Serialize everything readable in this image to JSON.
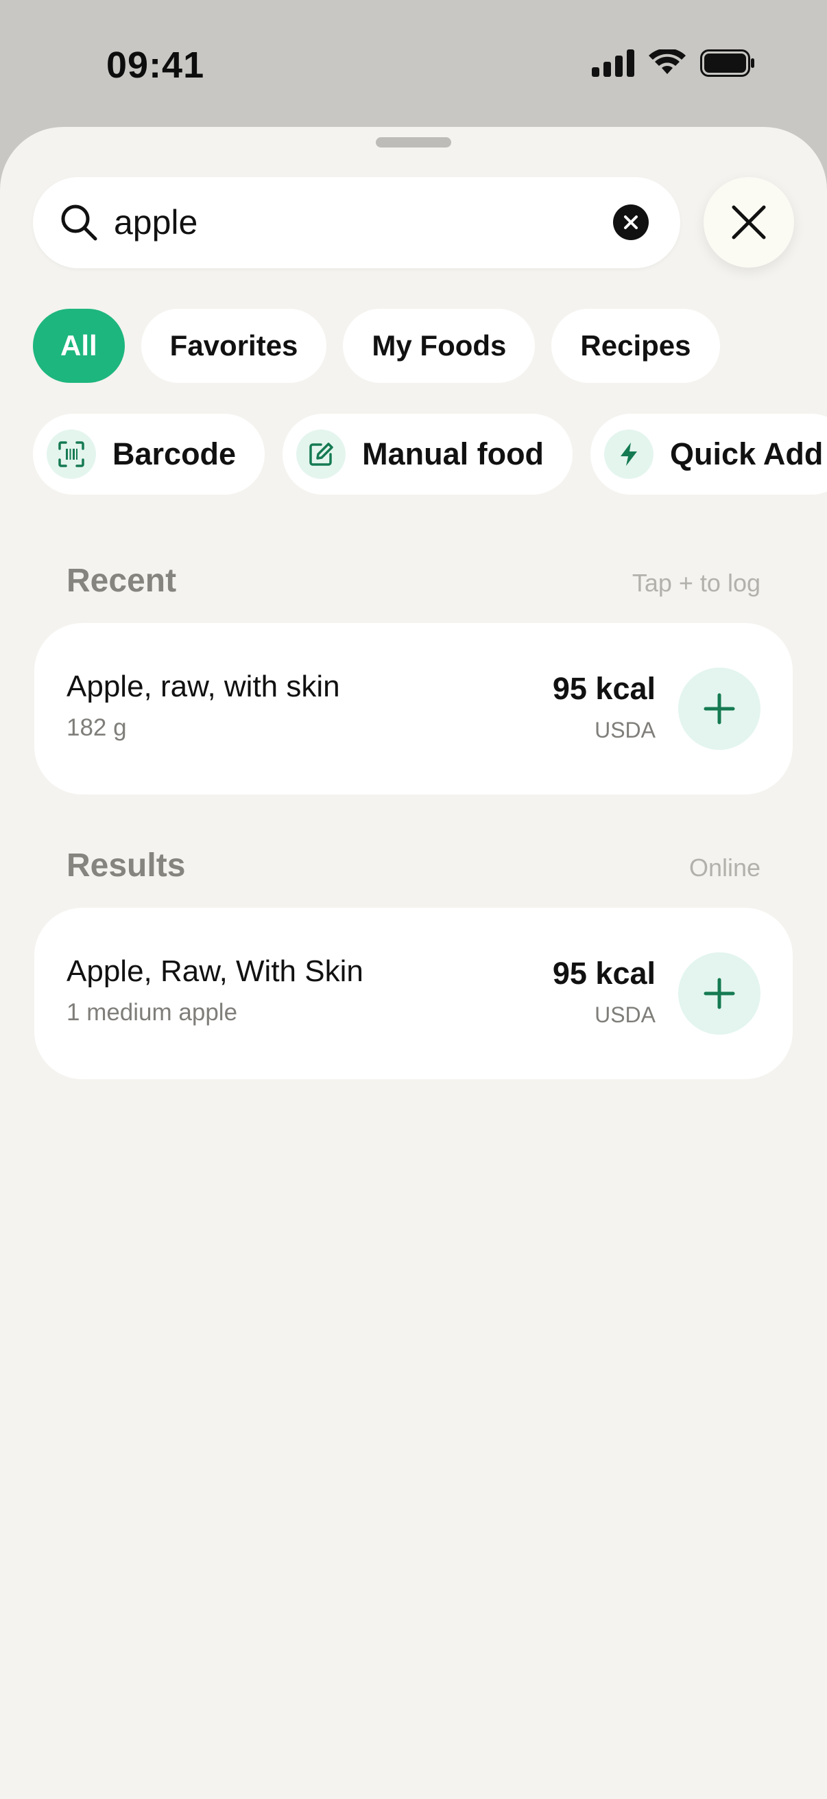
{
  "status_bar": {
    "time": "09:41",
    "icons": [
      "cellular-signal-icon",
      "wifi-icon",
      "battery-icon"
    ]
  },
  "search": {
    "value": "apple",
    "placeholder": ""
  },
  "filter_tabs": [
    {
      "label": "All",
      "active": true
    },
    {
      "label": "Favorites",
      "active": false
    },
    {
      "label": "My Foods",
      "active": false
    },
    {
      "label": "Recipes",
      "active": false
    }
  ],
  "quick_actions": [
    {
      "label": "Barcode",
      "icon": "barcode-scan-icon"
    },
    {
      "label": "Manual food",
      "icon": "edit-icon"
    },
    {
      "label": "Quick Add",
      "icon": "lightning-icon"
    }
  ],
  "recent": {
    "title": "Recent",
    "hint": "Tap + to log",
    "items": [
      {
        "name": "Apple, raw, with skin",
        "serving": "182 g",
        "kcal": "95 kcal",
        "source": "USDA"
      }
    ]
  },
  "results": {
    "title": "Results",
    "hint": "Online",
    "items": [
      {
        "name": "Apple, Raw, With Skin",
        "serving": "1 medium apple",
        "kcal": "95 kcal",
        "source": "USDA"
      }
    ]
  },
  "colors": {
    "accent": "#1db67e",
    "accent_icon": "#157a52",
    "accent_bg": "#e3f5ee",
    "sheet_bg": "#f4f3ef",
    "backdrop": "#c8c7c3"
  }
}
